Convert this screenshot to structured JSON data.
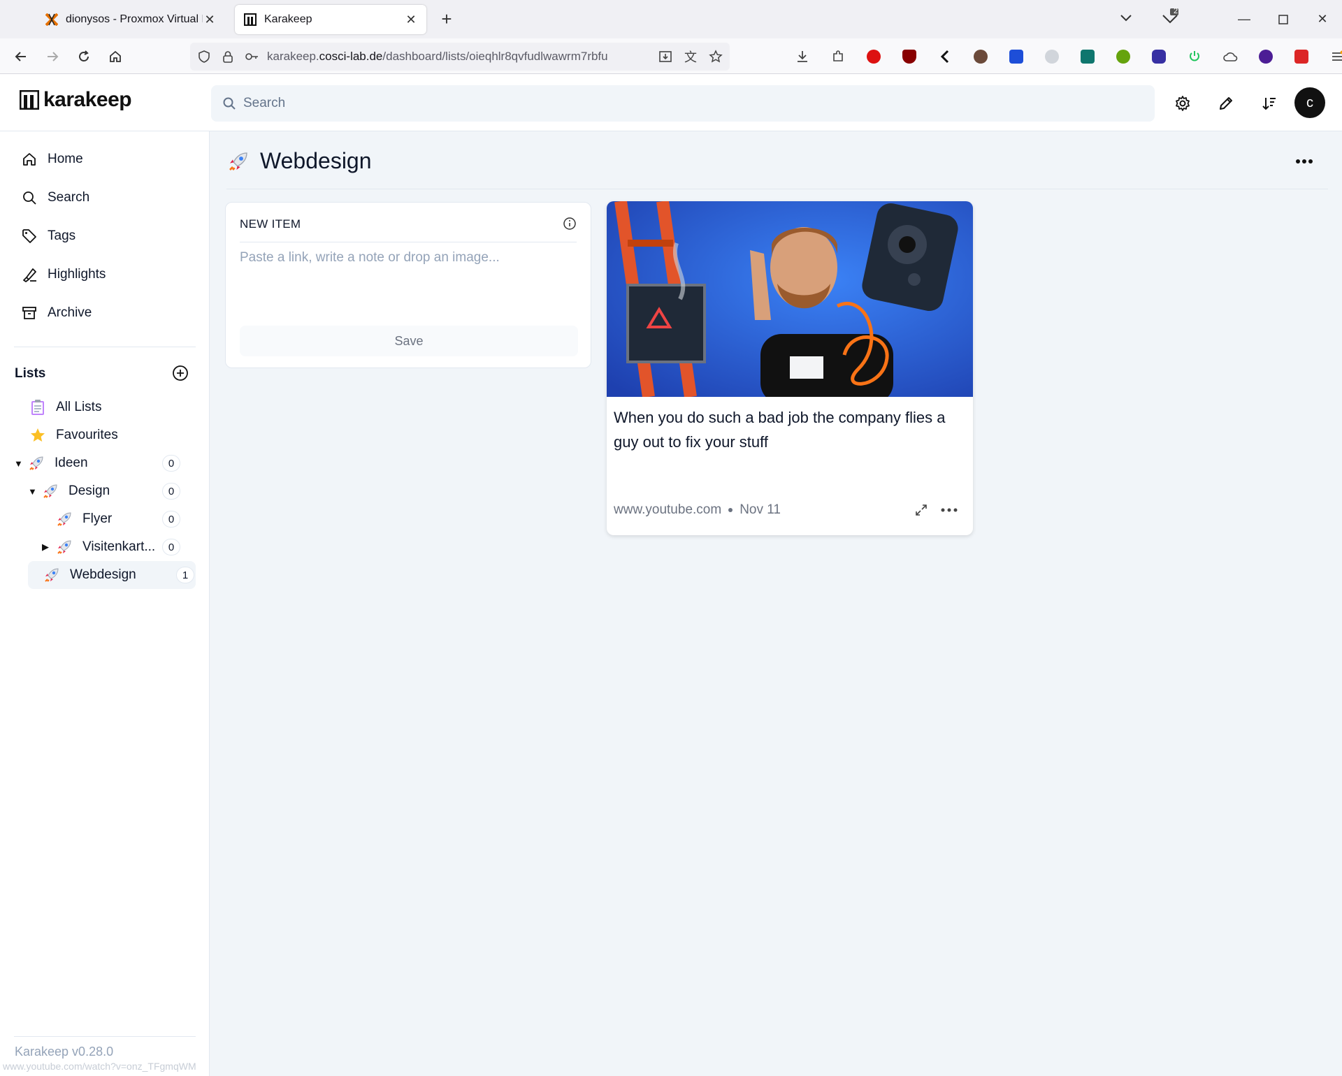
{
  "browser": {
    "tabs": [
      {
        "title": "dionysos - Proxmox Virtual Envi",
        "icon": "proxmox-icon",
        "active": false
      },
      {
        "title": "Karakeep",
        "icon": "karakeep-icon",
        "active": true
      }
    ],
    "url_prefix": "karakeep.",
    "url_domain": "cosci-lab.de",
    "url_path": "/dashboard/lists/oieqhlr8qvfudlwawrm7rbfu",
    "all_tabs_badge": "2",
    "status_url": "www.youtube.com/watch?v=onz_TFgmqWM"
  },
  "app": {
    "name": "karakeep",
    "search_placeholder": "Search",
    "avatar_letter": "c",
    "version": "Karakeep v0.28.0"
  },
  "sidebar": {
    "nav": [
      {
        "label": "Home",
        "icon": "home-icon"
      },
      {
        "label": "Search",
        "icon": "search-icon"
      },
      {
        "label": "Tags",
        "icon": "tag-icon"
      },
      {
        "label": "Highlights",
        "icon": "highlighter-icon"
      },
      {
        "label": "Archive",
        "icon": "archive-icon"
      }
    ],
    "lists_title": "Lists",
    "lists": [
      {
        "label": "All Lists",
        "emoji": "clipboard"
      },
      {
        "label": "Favourites",
        "emoji": "star"
      },
      {
        "label": "Ideen",
        "emoji": "rocket",
        "count": "0",
        "expanded": true
      },
      {
        "label": "Design",
        "emoji": "rocket",
        "count": "0",
        "expanded": true
      },
      {
        "label": "Flyer",
        "emoji": "rocket",
        "count": "0"
      },
      {
        "label": "Visitenkart...",
        "emoji": "rocket",
        "count": "0",
        "expanded": false
      },
      {
        "label": "Webdesign",
        "emoji": "rocket",
        "count": "1",
        "active": true
      }
    ]
  },
  "main": {
    "title": "Webdesign",
    "new_item": {
      "header": "NEW ITEM",
      "placeholder": "Paste a link, write a note or drop an image...",
      "save_label": "Save"
    },
    "bookmark": {
      "title": "When you do such a bad job the company flies a guy out to fix your stuff",
      "source": "www.youtube.com",
      "date": "Nov 11"
    }
  },
  "colors": {
    "accent": "#0f172a",
    "rocket": "#e11d48",
    "thumb_bg": "#1f5fd6"
  }
}
